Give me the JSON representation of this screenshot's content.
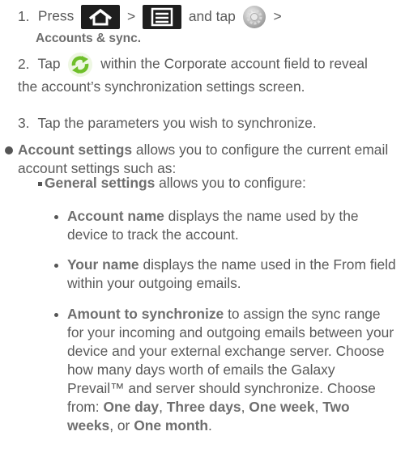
{
  "step1": {
    "number": "1.",
    "press": "Press",
    "gt1": ">",
    "and_tap": "and tap",
    "gt2": ">",
    "path": "Accounts & sync."
  },
  "step2": {
    "number": "2.",
    "tap": "Tap",
    "text": "within the Corporate account field to reveal the account’s synchronization settings screen."
  },
  "step3": {
    "number": "3.",
    "text": "Tap the parameters you wish to synchronize."
  },
  "account_settings": {
    "term": "Account settings",
    "text": "allows you to configure the current email account settings such as:"
  },
  "general_settings": {
    "term": "General settings",
    "text": "allows you to configure:"
  },
  "account_name": {
    "term": "Account name",
    "text": "displays the name used by the device to track the account."
  },
  "your_name": {
    "term": "Your name",
    "text": "displays the name used in the From field within your outgoing emails."
  },
  "amount_sync": {
    "term": "Amount to synchronize",
    "text": "to assign the sync range for your incoming and outgoing emails between your device and your external exchange server. Choose how many days worth of emails the Galaxy Prevail™ and server should synchronize. Choose from:",
    "opt1": "One day",
    "sep1": ",",
    "opt2": "Three days",
    "sep2": ",",
    "opt3": "One week",
    "sep3": ",",
    "opt4": "Two weeks",
    "sep4": ", or",
    "opt5": "One month",
    "end": "."
  },
  "icons": {
    "home": "home-icon",
    "menu": "menu-icon",
    "settings": "gear-icon",
    "sync": "sync-icon"
  },
  "colors": {
    "text": "#5a5a5a",
    "icon_bg": "#1e1e1e",
    "sync_green": "#6fbf2a"
  }
}
